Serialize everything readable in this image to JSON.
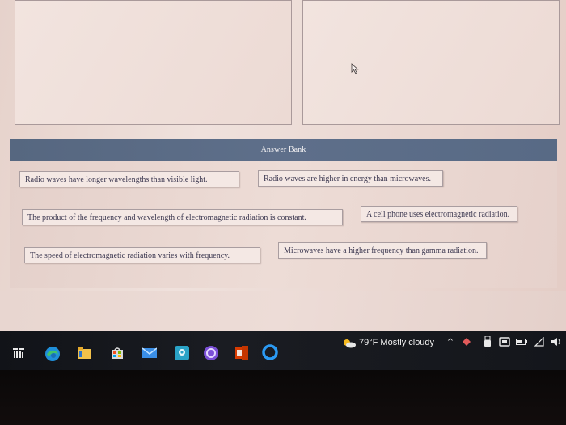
{
  "answer_bank": {
    "title": "Answer Bank",
    "items": [
      "Radio waves have longer wavelengths than visible light.",
      "Radio waves are higher in energy than microwaves.",
      "The product of the frequency and wavelength of electromagnetic radiation is constant.",
      "A cell phone uses electromagnetic radiation.",
      "The speed of electromagnetic radiation varies with frequency.",
      "Microwaves have a higher frequency than gamma radiation."
    ]
  },
  "taskbar": {
    "weather_text": "79°F  Mostly cloudy",
    "pinned_icons": [
      "widgets-icon",
      "edge-icon",
      "file-explorer-icon",
      "store-icon",
      "mail-icon",
      "maps-icon",
      "app-icon",
      "office-icon",
      "cortana-icon"
    ],
    "tray_icons": [
      "chevron-up-icon",
      "network-icon",
      "usb-icon",
      "tablet-icon",
      "battery-icon",
      "wifi-icon",
      "volume-icon"
    ]
  },
  "colors": {
    "header_blue": "#5e6f8a",
    "card_bg": "#f4e8e4",
    "text_color": "#3e3a52"
  }
}
